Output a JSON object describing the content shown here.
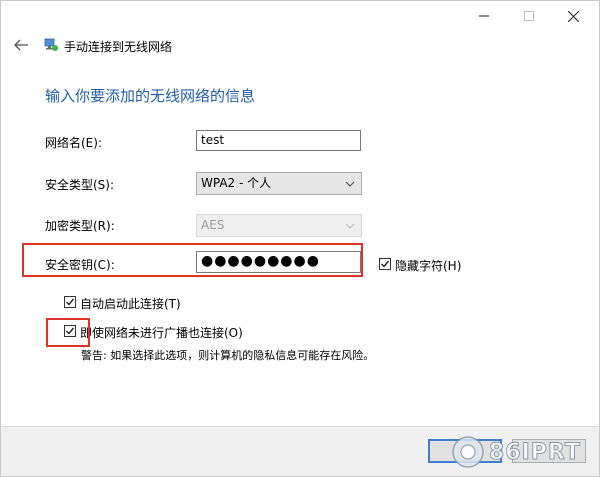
{
  "window": {
    "title": "手动连接到无线网络",
    "controls": {
      "minimize": "—",
      "maximize": "☐",
      "close": "✕"
    }
  },
  "heading": "输入你要添加的无线网络的信息",
  "form": {
    "network_name": {
      "label": "网络名(E):",
      "value": "test"
    },
    "security_type": {
      "label": "安全类型(S):",
      "value": "WPA2 - 个人"
    },
    "encryption_type": {
      "label": "加密类型(R):",
      "value": "AES",
      "disabled": true
    },
    "security_key": {
      "label": "安全密钥(C):",
      "masked_value": "●●●●●●●●●"
    },
    "hide_chars": {
      "label": "隐藏字符(H)",
      "checked": true
    },
    "auto_start": {
      "label": "自动启动此连接(T)",
      "checked": true
    },
    "connect_if_not_broadcasting": {
      "label": "即使网络未进行广播也连接(O)",
      "checked": true
    },
    "warning": "警告: 如果选择此选项，则计算机的隐私信息可能存在风险。"
  },
  "watermark": {
    "text": "86IPRT"
  },
  "colors": {
    "heading": "#1e5fa8",
    "highlight": "#e0312b",
    "focus_border": "#3c7fd0"
  },
  "icons": {
    "back": "back-arrow-icon",
    "network": "network-icon",
    "chevron": "chevron-down-icon",
    "check": "checkmark-icon"
  }
}
